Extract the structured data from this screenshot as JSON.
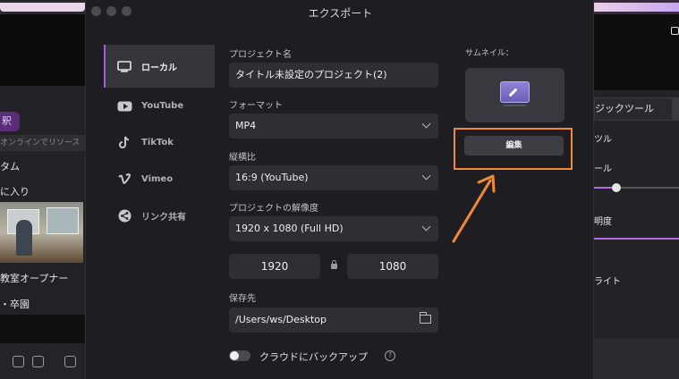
{
  "background_app": {
    "left_panel": {
      "chip_label": "釈",
      "search_placeholder": "オンラインでリソース",
      "row_custom": "タム",
      "row_favorites": "に入り",
      "row_opener": "教室オープナー",
      "row_graduation": "・卒園"
    },
    "right_panel": {
      "magic_tools_tab": "ジックツール",
      "tool_section": "ツル",
      "scale_label": "ール",
      "opacity_label": "明度",
      "light_label": "ライト"
    }
  },
  "dialog": {
    "title": "エクスポート",
    "sidebar": [
      {
        "label": "ローカル",
        "icon": "local-monitor-icon",
        "active": true
      },
      {
        "label": "YouTube",
        "icon": "youtube-icon",
        "active": false
      },
      {
        "label": "TikTok",
        "icon": "tiktok-icon",
        "active": false
      },
      {
        "label": "Vimeo",
        "icon": "vimeo-icon",
        "active": false
      },
      {
        "label": "リンク共有",
        "icon": "share-icon",
        "active": false
      }
    ],
    "form": {
      "project_name_label": "プロジェクト名",
      "project_name_value": "タイトル未設定のプロジェクト(2)",
      "format_label": "フォーマット",
      "format_value": "MP4",
      "aspect_label": "縦横比",
      "aspect_value": "16:9 (YouTube)",
      "resolution_label": "プロジェクトの解像度",
      "resolution_value": "1920 x 1080 (Full HD)",
      "width_value": "1920",
      "height_value": "1080",
      "save_label": "保存先",
      "save_value": "/Users/ws/Desktop",
      "cloud_backup_label": "クラウドにバックアップ",
      "cloud_backup_on": false
    },
    "thumbnail": {
      "label": "サムネイル：",
      "edit_button": "編集"
    }
  },
  "annotation": {
    "highlight_color": "#f08a34"
  }
}
